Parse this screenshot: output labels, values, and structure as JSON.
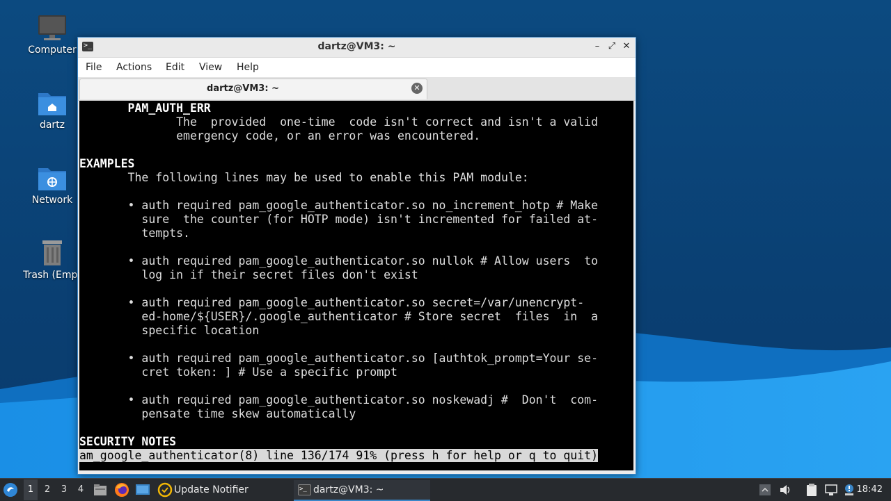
{
  "desktop": {
    "icons": [
      {
        "label": "Computer"
      },
      {
        "label": "dartz"
      },
      {
        "label": "Network"
      },
      {
        "label": "Trash (Empt"
      }
    ]
  },
  "window": {
    "title": "dartz@VM3: ~",
    "controls": {
      "minimize": "–",
      "maximize": "⤢",
      "close": "✕"
    },
    "menu": [
      "File",
      "Actions",
      "Edit",
      "View",
      "Help"
    ],
    "tab": {
      "label": "dartz@VM3: ~",
      "close": "✕"
    }
  },
  "terminal": {
    "lines": [
      {
        "text": "       PAM_AUTH_ERR",
        "bold": true
      },
      {
        "text": "              The  provided  one-time  code isn't correct and isn't a valid"
      },
      {
        "text": "              emergency code, or an error was encountered."
      },
      {
        "text": ""
      },
      {
        "text": "EXAMPLES",
        "bold": true
      },
      {
        "text": "       The following lines may be used to enable this PAM module:"
      },
      {
        "text": ""
      },
      {
        "text": "       • auth required pam_google_authenticator.so no_increment_hotp # Make"
      },
      {
        "text": "         sure  the counter (for HOTP mode) isn't incremented for failed at‐"
      },
      {
        "text": "         tempts."
      },
      {
        "text": ""
      },
      {
        "text": "       • auth required pam_google_authenticator.so nullok # Allow users  to"
      },
      {
        "text": "         log in if their secret files don't exist"
      },
      {
        "text": ""
      },
      {
        "text": "       • auth required pam_google_authenticator.so secret=/var/unencrypt‐"
      },
      {
        "text": "         ed-home/${USER}/.google_authenticator # Store secret  files  in  a"
      },
      {
        "text": "         specific location"
      },
      {
        "text": ""
      },
      {
        "text": "       • auth required pam_google_authenticator.so [authtok_prompt=Your se‐"
      },
      {
        "text": "         cret token: ] # Use a specific prompt"
      },
      {
        "text": ""
      },
      {
        "text": "       • auth required pam_google_authenticator.so noskewadj #  Don't  com‐"
      },
      {
        "text": "         pensate time skew automatically"
      },
      {
        "text": ""
      },
      {
        "text": "SECURITY NOTES",
        "bold": true
      }
    ],
    "status_line": "am_google_authenticator(8) line 136/174 91% (press h for help or q to quit)"
  },
  "taskbar": {
    "workspaces": [
      "1",
      "2",
      "3",
      "4"
    ],
    "active_workspace": "1",
    "tasks": [
      {
        "label": "Update Notifier"
      },
      {
        "label": "dartz@VM3: ~"
      }
    ],
    "clock": "18:42"
  },
  "colors": {
    "terminal_bg": "#000000",
    "terminal_fg": "#dedede",
    "accent": "#3a86c8",
    "taskbar_bg": "#272a2e"
  }
}
